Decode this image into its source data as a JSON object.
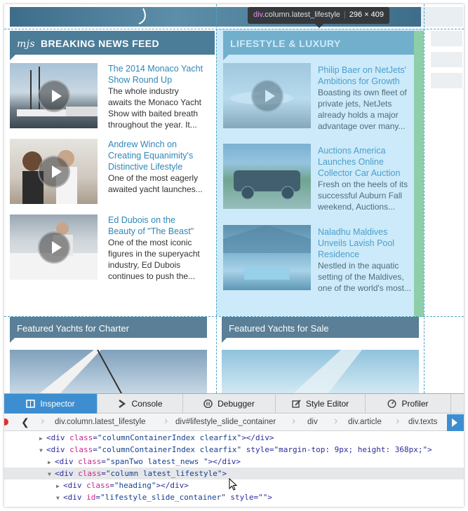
{
  "page": {
    "news_heading_logo": "mjs",
    "news_heading": "BREAKING NEWS FEED",
    "lifestyle_heading": "LIFESTYLE & LUXURY",
    "news_articles": [
      {
        "title": "The 2014 Monaco Yacht Show Round Up",
        "text": "The whole industry awaits the Monaco Yacht Show with baited breath throughout the year. It..."
      },
      {
        "title": "Andrew Winch on Creating Equanimity's Distinctive Lifestyle",
        "text": "One of the most eagerly awaited yacht launches..."
      },
      {
        "title": "Ed Dubois on the Beauty of \"The Beast\"",
        "text": "One of the most iconic figures in the superyacht industry, Ed Dubois continues to push the..."
      }
    ],
    "lifestyle_articles": [
      {
        "title": "Philip Baer on NetJets' Ambitions for Growth",
        "text": "Boasting its own fleet of private jets, NetJets already holds a major advantage over many..."
      },
      {
        "title": "Auctions America Launches Online Collector Car Auction",
        "text": "Fresh on the heels of its successful Auburn Fall weekend, Auctions..."
      },
      {
        "title": "Naladhu Maldives Unveils Lavish Pool Residence",
        "text": "Nestled in the aquatic setting of the Maldives, one of the world's most..."
      }
    ],
    "featured_charter": "Featured Yachts for Charter",
    "featured_sale": "Featured Yachts for Sale"
  },
  "tooltip": {
    "element": "div",
    "classes": ".column.latest_lifestyle",
    "dimensions": "296 × 409"
  },
  "devtools": {
    "tabs": [
      {
        "label": "Inspector",
        "icon": "inspector-icon",
        "active": true
      },
      {
        "label": "Console",
        "icon": "console-icon"
      },
      {
        "label": "Debugger",
        "icon": "debugger-icon"
      },
      {
        "label": "Style Editor",
        "icon": "style-editor-icon"
      },
      {
        "label": "Profiler",
        "icon": "profiler-icon"
      }
    ],
    "breadcrumbs": [
      "div.column.latest_lifestyle",
      "div#lifestyle_slide_container",
      "div",
      "div.article",
      "div.texts"
    ],
    "markup": [
      {
        "tw": "▶",
        "pre": "<div ",
        "attr": "class",
        "val": "\"columnContainerIndex clearfix\"",
        "post": "></div>"
      },
      {
        "tw": "▼",
        "pre": "<div ",
        "attr": "class",
        "val": "\"columnContainerIndex clearfix\"",
        "post": " style=\"margin-top: 9px; height: 368px;\">"
      },
      {
        "tw": "▶",
        "pre": "<div ",
        "attr": "class",
        "val": "\"spanTwo latest_news \"",
        "post": "></div>"
      },
      {
        "tw": "▼",
        "pre": "<div ",
        "attr": "class",
        "val": "\"column latest_lifestyle\"",
        "post": ">"
      },
      {
        "tw": "▶",
        "pre": "<div ",
        "attr": "class",
        "val": "\"heading\"",
        "post": "></div>"
      },
      {
        "tw": "▼",
        "pre": "<div ",
        "attr": "id",
        "val": "\"lifestyle_slide_container\"",
        "post": " style=\"\">"
      }
    ]
  },
  "colors": {
    "accent": "#3d8ed0",
    "highlight": "#78c8f0",
    "news_heading_bg": "#4b7c98",
    "link": "#2f86b8"
  }
}
